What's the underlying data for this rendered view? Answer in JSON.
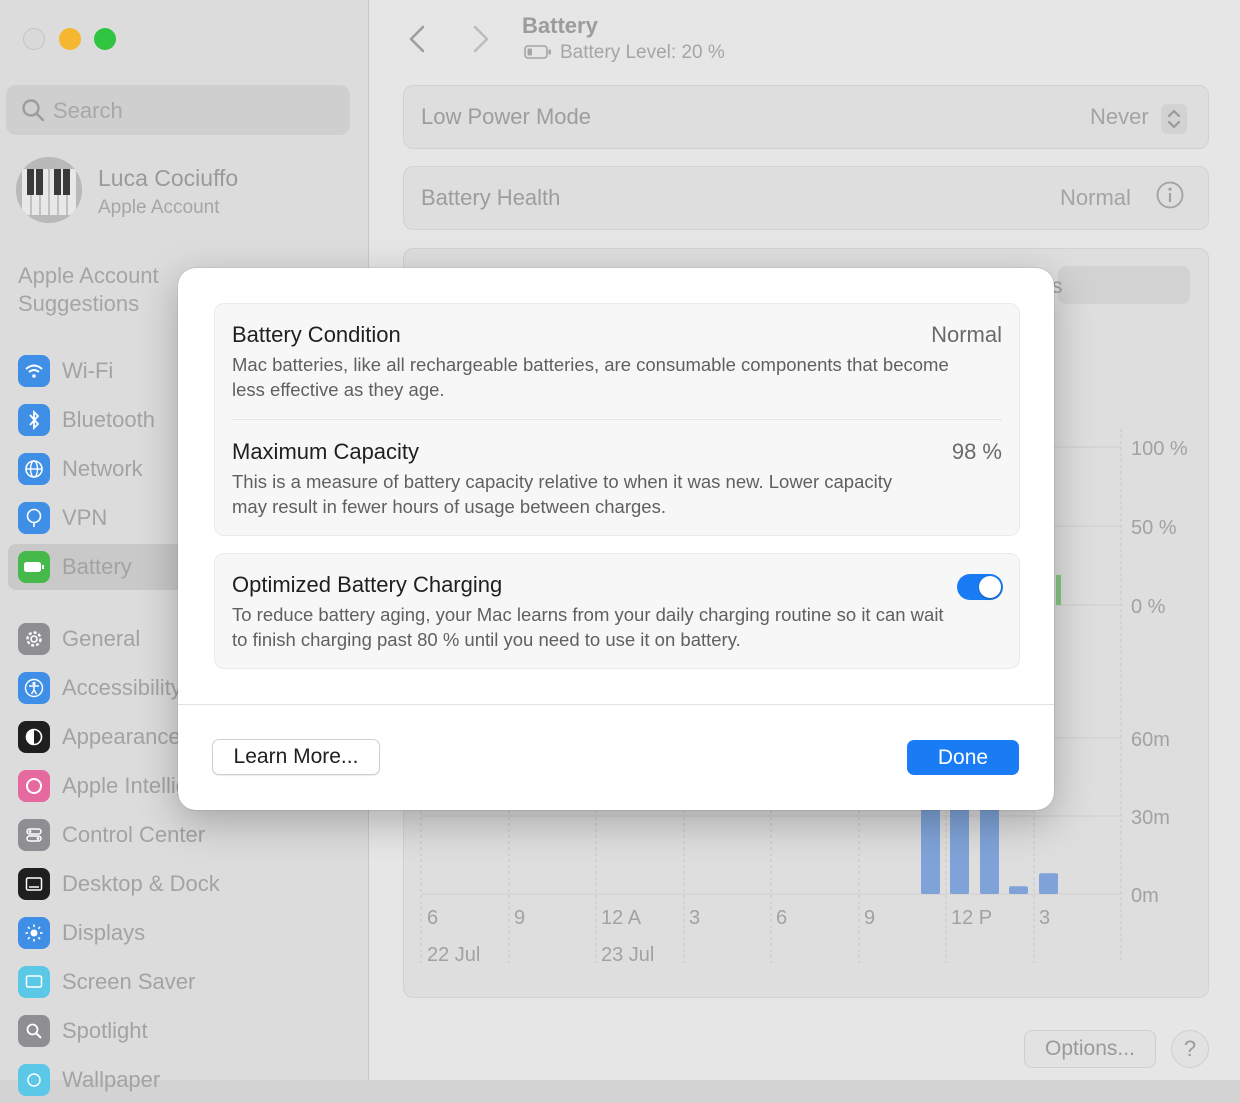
{
  "sidebar": {
    "search_placeholder": "Search",
    "account": {
      "name": "Luca Cociuffo",
      "subtitle": "Apple Account"
    },
    "suggestions": "Apple Account Suggestions",
    "items": [
      {
        "label": "Wi-Fi",
        "icon": "wifi-icon",
        "color": "#3f8fe6"
      },
      {
        "label": "Bluetooth",
        "icon": "bluetooth-icon",
        "color": "#3f8fe6"
      },
      {
        "label": "Network",
        "icon": "globe-icon",
        "color": "#3f8fe6"
      },
      {
        "label": "VPN",
        "icon": "vpn-icon",
        "color": "#3f8fe6"
      },
      {
        "label": "Battery",
        "icon": "battery-icon",
        "color": "#45b94a"
      },
      {
        "label": "General",
        "icon": "gear-icon",
        "color": "#8e8e93"
      },
      {
        "label": "Accessibility",
        "icon": "accessibility-icon",
        "color": "#3f8fe6"
      },
      {
        "label": "Appearance",
        "icon": "appearance-icon",
        "color": "#1f1f1f"
      },
      {
        "label": "Apple Intelligence & Siri",
        "icon": "siri-icon",
        "color": "#e66aa0"
      },
      {
        "label": "Control Center",
        "icon": "control-center-icon",
        "color": "#8e8e93"
      },
      {
        "label": "Desktop & Dock",
        "icon": "dock-icon",
        "color": "#1f1f1f"
      },
      {
        "label": "Displays",
        "icon": "displays-icon",
        "color": "#3f8fe6"
      },
      {
        "label": "Screen Saver",
        "icon": "screensaver-icon",
        "color": "#5ac8e6"
      },
      {
        "label": "Spotlight",
        "icon": "spotlight-icon",
        "color": "#8e8e93"
      },
      {
        "label": "Wallpaper",
        "icon": "wallpaper-icon",
        "color": "#5ac8e6"
      }
    ]
  },
  "header": {
    "title": "Battery",
    "battery_level": "Battery Level: 20 %"
  },
  "settings": {
    "low_power_mode_label": "Low Power Mode",
    "low_power_mode_value": "Never",
    "battery_health_label": "Battery Health",
    "battery_health_value": "Normal",
    "tab_partial": "s"
  },
  "chart_data": {
    "type": "bar",
    "level_axis_labels": [
      "100 %",
      "50 %",
      "0 %"
    ],
    "usage_axis_labels": [
      "60m",
      "30m",
      "0m"
    ],
    "x_tick_labels": [
      "6",
      "9",
      "12 A",
      "3",
      "6",
      "9",
      "12 P",
      "3"
    ],
    "date_labels": [
      "22 Jul",
      "23 Jul"
    ],
    "screen_on_usage_minutes": [
      48,
      48,
      48,
      3,
      8
    ]
  },
  "footer": {
    "options_label": "Options...",
    "help_label": "?"
  },
  "modal": {
    "condition_title": "Battery Condition",
    "condition_value": "Normal",
    "condition_desc": "Mac batteries, like all rechargeable batteries, are consumable components that become less effective as they age.",
    "capacity_title": "Maximum Capacity",
    "capacity_value": "98 %",
    "capacity_desc": "This is a measure of battery capacity relative to when it was new. Lower capacity may result in fewer hours of usage between charges.",
    "optimized_title": "Optimized Battery Charging",
    "optimized_desc": "To reduce battery aging, your Mac learns from your daily charging routine so it can wait to finish charging past 80 % until you need to use it on battery.",
    "optimized_enabled": true,
    "learn_more_label": "Learn More...",
    "done_label": "Done",
    "accent_color": "#1a7cf4"
  }
}
